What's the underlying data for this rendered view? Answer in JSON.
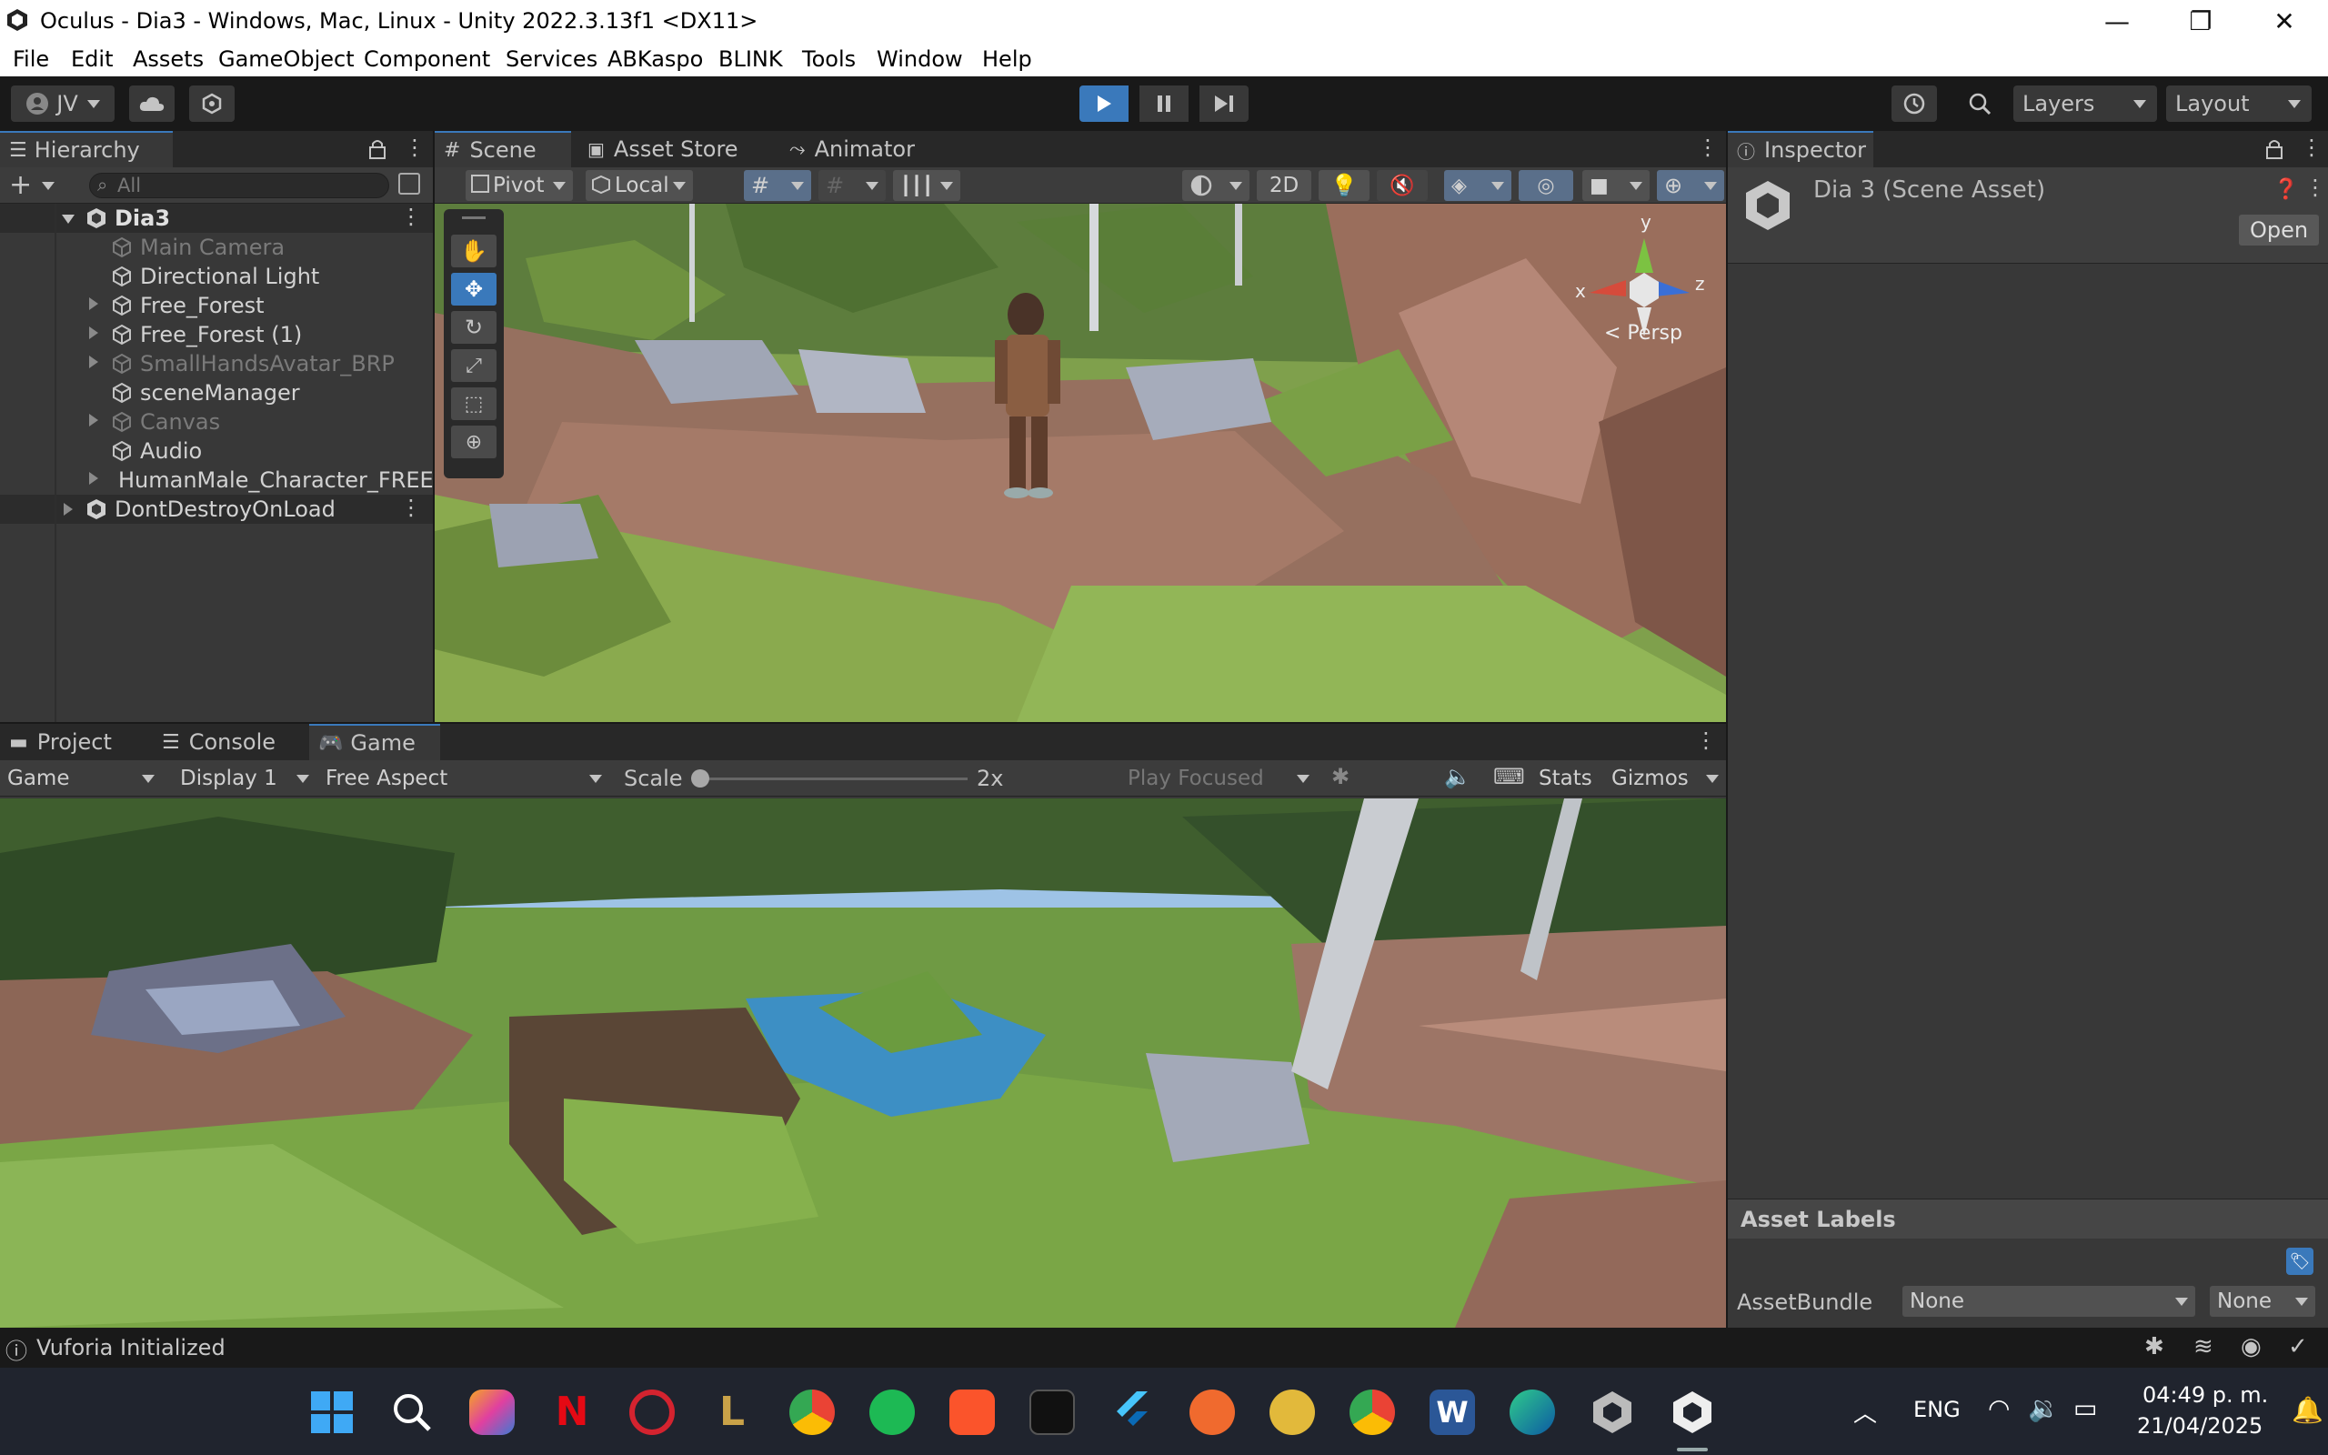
{
  "window": {
    "title": "Oculus - Dia3 - Windows, Mac, Linux - Unity 2022.3.13f1 <DX11>",
    "minimize_glyph": "—",
    "maximize_glyph": "❐",
    "close_glyph": "✕"
  },
  "menu": [
    "File",
    "Edit",
    "Assets",
    "GameObject",
    "Component",
    "Services",
    "ABKaspo",
    "BLINK",
    "Tools",
    "Window",
    "Help"
  ],
  "toolbar": {
    "account": "JV",
    "layers": "Layers",
    "layout": "Layout",
    "play_icon": "play-icon",
    "pause_icon": "pause-icon",
    "step_icon": "step-icon"
  },
  "hierarchy": {
    "tab": "Hierarchy",
    "search_placeholder": "All",
    "scene": "Dia3",
    "items": [
      {
        "label": "Main Camera",
        "dim": true
      },
      {
        "label": "Directional Light",
        "dim": false
      },
      {
        "label": "Free_Forest",
        "dim": false
      },
      {
        "label": "Free_Forest (1)",
        "dim": false
      },
      {
        "label": "SmallHandsAvatar_BRP",
        "dim": true
      },
      {
        "label": "sceneManager",
        "dim": false
      },
      {
        "label": "Canvas",
        "dim": true
      },
      {
        "label": "Audio",
        "dim": false
      },
      {
        "label": "HumanMale_Character_FREE",
        "dim": false
      }
    ],
    "dont_destroy": "DontDestroyOnLoad"
  },
  "scene_view": {
    "tabs": [
      "Scene",
      "Asset Store",
      "Animator"
    ],
    "pivot": "Pivot",
    "local": "Local",
    "mode_2d": "2D",
    "persp": "< Persp",
    "axis_x": "x",
    "axis_y": "y",
    "axis_z": "z"
  },
  "inspector": {
    "tab": "Inspector",
    "asset_name": "Dia 3 (Scene Asset)",
    "open_button": "Open",
    "asset_labels": "Asset Labels",
    "asset_bundle_label": "AssetBundle",
    "asset_bundle_value": "None",
    "asset_variant_value": "None"
  },
  "game_view": {
    "tabs": [
      "Project",
      "Console",
      "Game"
    ],
    "mode": "Game",
    "display": "Display 1",
    "aspect": "Free Aspect",
    "scale_label": "Scale",
    "scale_value": "2x",
    "play_focused": "Play Focused",
    "stats": "Stats",
    "gizmos": "Gizmos"
  },
  "status": {
    "message": "Vuforia Initialized"
  },
  "taskbar": {
    "lang": "ENG",
    "time": "04:49 p. m.",
    "date": "21/04/2025"
  },
  "colors": {
    "accent": "#3a79bb",
    "panel": "#383838",
    "dark": "#191919"
  }
}
